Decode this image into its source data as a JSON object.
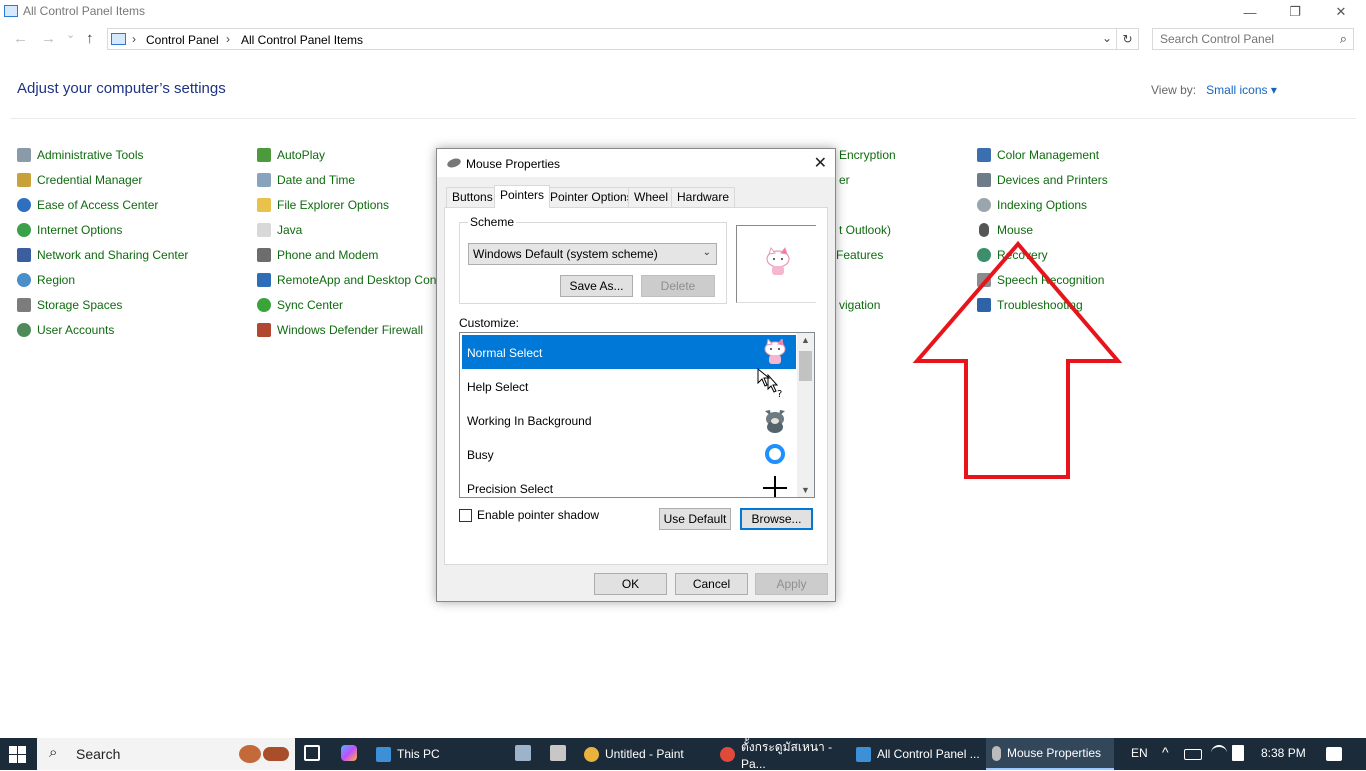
{
  "window": {
    "title": "All Control Panel Items",
    "minimize_glyph": "—",
    "maximize_glyph": "❐",
    "close_glyph": "✕"
  },
  "nav": {
    "back_glyph": "←",
    "forward_glyph": "→",
    "recent_glyph": "⌄",
    "up_glyph": "↑",
    "breadcrumb": [
      "Control Panel",
      "All Control Panel Items"
    ],
    "crumb_sep": "›",
    "dropdown_glyph": "⌄",
    "refresh_glyph": "↻",
    "search_placeholder": "Search Control Panel",
    "search_glyph": "⌕"
  },
  "page": {
    "heading": "Adjust your computer’s settings",
    "view_by_label": "View by:",
    "view_by_value": "Small icons ▾"
  },
  "items": {
    "col1": [
      "Administrative Tools",
      "Credential Manager",
      "Ease of Access Center",
      "Internet Options",
      "Network and Sharing Center",
      "Region",
      "Storage Spaces",
      "User Accounts"
    ],
    "col2": [
      "AutoPlay",
      "Date and Time",
      "File Explorer Options",
      "Java",
      "Phone and Modem",
      "RemoteApp and Desktop Connections",
      "Sync Center",
      "Windows Defender Firewall"
    ],
    "col3_visible": [
      "Encryption",
      "er",
      "t Outlook)",
      "Features",
      "vigation"
    ],
    "col4": [
      "Color Management",
      "Devices and Printers",
      "Indexing Options",
      "Mouse",
      "Recovery",
      "Speech Recognition",
      "Troubleshooting"
    ]
  },
  "dialog": {
    "title": "Mouse Properties",
    "close_glyph": "✕",
    "tabs": [
      "Buttons",
      "Pointers",
      "Pointer Options",
      "Wheel",
      "Hardware"
    ],
    "active_tab": "Pointers",
    "scheme_label": "Scheme",
    "scheme_value": "Windows Default (system scheme)",
    "scheme_arrow": "⌄",
    "save_as": "Save As...",
    "delete": "Delete",
    "customize_label": "Customize:",
    "cursors": [
      "Normal Select",
      "Help Select",
      "Working In Background",
      "Busy",
      "Precision Select"
    ],
    "selected_cursor": "Normal Select",
    "scroll_up": "▲",
    "scroll_down": "▼",
    "shadow_label": "Enable pointer shadow",
    "shadow_checked": false,
    "use_default": "Use Default",
    "browse": "Browse...",
    "ok": "OK",
    "cancel": "Cancel",
    "apply": "Apply"
  },
  "taskbar": {
    "search_label": "Search",
    "search_glyph": "⌕",
    "apps": [
      "This PC",
      "Untitled - Paint",
      "ตั้งกระดูมัสเหนา - Pa...",
      "All Control Panel ...",
      "Mouse Properties"
    ],
    "active_app": "Mouse Properties",
    "language": "EN",
    "tray_chevron": "^",
    "time": "8:38 PM"
  },
  "colors": {
    "link_green": "#0f6b0f",
    "heading_blue": "#1e3287",
    "accent": "#0078d7",
    "annotation_red": "#e8141c",
    "taskbar": "#1c2b3a"
  }
}
